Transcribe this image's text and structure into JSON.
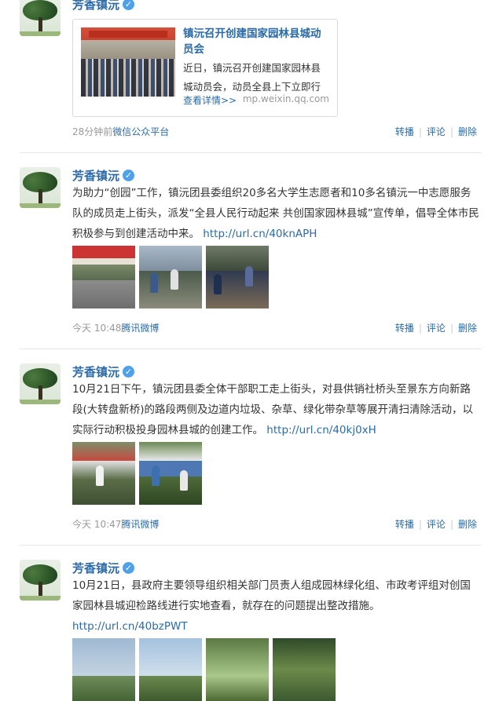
{
  "posts": [
    {
      "author": "芳香镇沅",
      "verified_mark": "✓",
      "share": {
        "title": "镇沅召开创建国家园林县城动员会",
        "desc": "近日，镇沅召开创建国家园林县城动员会，动员全县上下立即行",
        "more": "查看详情>>",
        "source": "mp.weixin.qq.com"
      },
      "time": "28分钟前",
      "via": "微信公众平台",
      "actions": {
        "repost": "转播",
        "comment": "评论",
        "delete": "删除"
      }
    },
    {
      "author": "芳香镇沅",
      "verified_mark": "✓",
      "text": "为助力“创园”工作，镇沅团县委组织20多名大学生志愿者和10多名镇沅一中志愿服务队的成员走上街头，派发“全县人民行动起来 共创国家园林县城”宣传单，倡导全体市民积极参与到创建活动中来。",
      "link": "http://url.cn/40knAPH",
      "time": "今天 10:48",
      "via": "腾讯微博",
      "actions": {
        "repost": "转播",
        "comment": "评论",
        "delete": "删除"
      }
    },
    {
      "author": "芳香镇沅",
      "verified_mark": "✓",
      "text": "10月21日下午，镇沅团县委全体干部职工走上街头，对县供销社桥头至景东方向新路段(大转盘新桥)的路段两侧及边道内垃圾、杂草、绿化带杂草等展开清扫清除活动，以实际行动积极投身园林县城的创建工作。",
      "link": "http://url.cn/40kj0xH",
      "time": "今天 10:47",
      "via": "腾讯微博",
      "actions": {
        "repost": "转播",
        "comment": "评论",
        "delete": "删除"
      }
    },
    {
      "author": "芳香镇沅",
      "verified_mark": "✓",
      "text": "10月21日，县政府主要领导组织相关部门员责人组成园林绿化组、市政考评组对创国家园林县城迎检路线进行实地查看，就存在的问题提出整改措施。",
      "link": "http://url.cn/40bzPWT"
    }
  ]
}
